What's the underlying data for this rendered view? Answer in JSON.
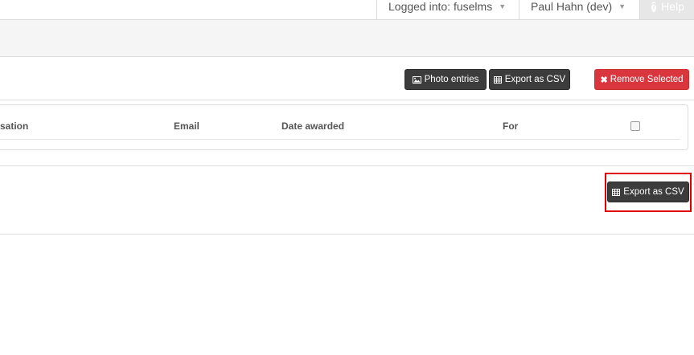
{
  "topbar": {
    "logged_in_label": "Logged into: fuselms",
    "user_label": "Paul Hahn (dev)",
    "help_label": "Help"
  },
  "toolbar": {
    "photo_entries_label": "Photo entries",
    "export_csv_label": "Export as CSV",
    "remove_selected_label": "Remove Selected"
  },
  "table": {
    "columns": [
      "sation",
      "Email",
      "Date awarded",
      "For"
    ]
  },
  "footer": {
    "export_csv_label": "Export as CSV"
  },
  "colors": {
    "dark_button": "#3c3c3c",
    "danger_button": "#d9363e",
    "highlight": "#e00000"
  }
}
